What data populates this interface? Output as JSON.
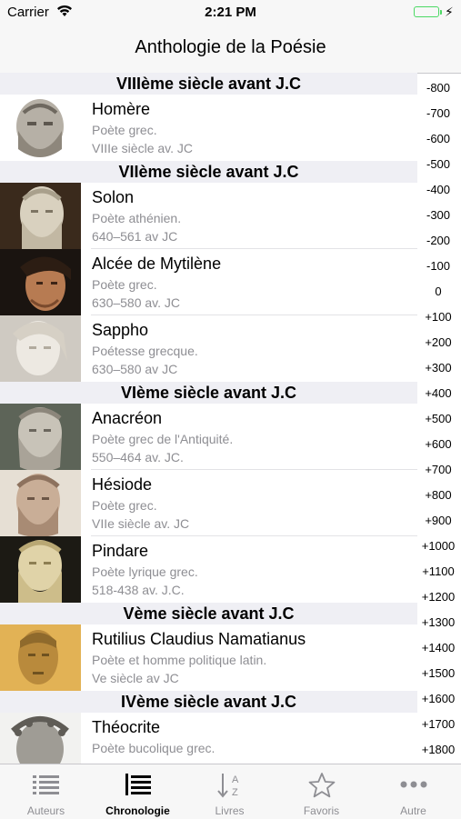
{
  "status": {
    "carrier": "Carrier",
    "time": "2:21 PM",
    "battery_color": "#4cd964"
  },
  "nav": {
    "title": "Anthologie de la Poésie"
  },
  "sections": [
    {
      "title": "VIIIème siècle avant J.C",
      "rows": [
        {
          "name": "Homère",
          "desc": "Poète grec.",
          "date": "VIIIe siècle av. JC",
          "icon": "homer-portrait"
        }
      ]
    },
    {
      "title": "VIIème siècle avant J.C",
      "rows": [
        {
          "name": "Solon",
          "desc": "Poète athénien.",
          "date": "640–561 av JC",
          "icon": "solon-portrait"
        },
        {
          "name": "Alcée de Mytilène",
          "desc": "Poète grec.",
          "date": "630–580 av.  JC",
          "icon": "alcaeus-portrait"
        },
        {
          "name": "Sappho",
          "desc": "Poétesse grecque.",
          "date": "630–580 av JC",
          "icon": "sappho-portrait"
        }
      ]
    },
    {
      "title": "VIème siècle avant J.C",
      "rows": [
        {
          "name": "Anacréon",
          "desc": "Poète grec de l'Antiquité.",
          "date": "550–464 av. JC.",
          "icon": "anacreon-portrait"
        },
        {
          "name": "Hésiode",
          "desc": "Poète grec.",
          "date": "VIIe siècle av. JC",
          "icon": "hesiod-portrait"
        },
        {
          "name": "Pindare",
          "desc": "Poète lyrique grec.",
          "date": "518-438 av. J.C.",
          "icon": "pindar-portrait"
        }
      ]
    },
    {
      "title": "Vème siècle avant J.C",
      "rows": [
        {
          "name": "Rutilius Claudius Namatianus",
          "desc": "Poète et homme politique latin.",
          "date": "Ve siècle av JC",
          "icon": "rutilius-portrait"
        }
      ]
    },
    {
      "title": "IVème siècle avant J.C",
      "rows": [
        {
          "name": "Théocrite",
          "desc": "Poète bucolique grec.",
          "date": "",
          "icon": "theocritus-portrait"
        }
      ]
    }
  ],
  "index": [
    "-800",
    "-700",
    "-600",
    "-500",
    "-400",
    "-300",
    "-200",
    "-100",
    "0",
    "+100",
    "+200",
    "+300",
    "+400",
    "+500",
    "+600",
    "+700",
    "+800",
    "+900",
    "+1000",
    "+1100",
    "+1200",
    "+1300",
    "+1400",
    "+1500",
    "+1600",
    "+1700",
    "+1800"
  ],
  "tabs": [
    {
      "label": "Auteurs",
      "icon": "list-icon",
      "active": false
    },
    {
      "label": "Chronologie",
      "icon": "timeline-icon",
      "active": true
    },
    {
      "label": "Livres",
      "icon": "sort-az-icon",
      "active": false
    },
    {
      "label": "Favoris",
      "icon": "star-icon",
      "active": false
    },
    {
      "label": "Autre",
      "icon": "more-icon",
      "active": false
    }
  ]
}
